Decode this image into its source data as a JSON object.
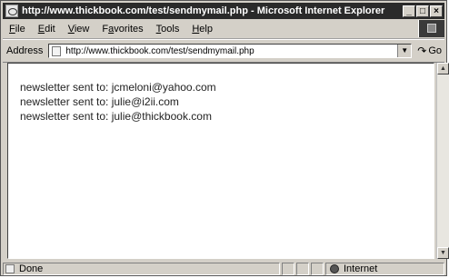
{
  "window": {
    "title": "http://www.thickbook.com/test/sendmymail.php - Microsoft Internet Explorer",
    "controls": {
      "minimize": "_",
      "maximize": "□",
      "close": "×"
    }
  },
  "menu": [
    {
      "pre": "",
      "u": "F",
      "post": "ile"
    },
    {
      "pre": "",
      "u": "E",
      "post": "dit"
    },
    {
      "pre": "",
      "u": "V",
      "post": "iew"
    },
    {
      "pre": "F",
      "u": "a",
      "post": "vorites"
    },
    {
      "pre": "",
      "u": "T",
      "post": "ools"
    },
    {
      "pre": "",
      "u": "H",
      "post": "elp"
    }
  ],
  "address": {
    "label": "Address",
    "url": "http://www.thickbook.com/test/sendmymail.php",
    "go_label": "Go"
  },
  "content": {
    "lines": [
      "newsletter sent to: jcmeloni@yahoo.com",
      "newsletter sent to: julie@i2ii.com",
      "newsletter sent to: julie@thickbook.com"
    ]
  },
  "status": {
    "text": "Done",
    "zone": "Internet"
  }
}
